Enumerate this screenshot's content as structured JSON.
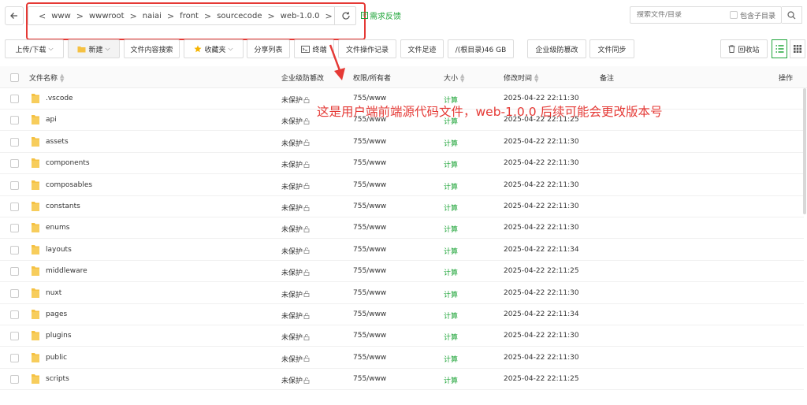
{
  "path": {
    "crumbs": [
      "www",
      "wwwroot",
      "naiai",
      "front",
      "sourcecode",
      "web-1.0.0"
    ],
    "feedback": "需求反馈"
  },
  "search": {
    "placeholder": "搜索文件/目录",
    "subdir_label": "包含子目录"
  },
  "toolbar": {
    "upload": "上传/下载",
    "new": "新建",
    "content_search": "文件内容搜索",
    "favorites": "收藏夹",
    "share_list": "分享列表",
    "terminal": "终端",
    "op_log": "文件操作记录",
    "footprint": "文件足迹",
    "disk": "/(根目录)46 GB",
    "tamper": "企业级防篡改",
    "sync": "文件同步",
    "recycle": "回收站"
  },
  "table": {
    "headers": {
      "name": "文件名称",
      "tamper": "企业级防篡改",
      "perm": "权限/所有者",
      "size": "大小",
      "mtime": "修改时间",
      "remark": "备注",
      "ops": "操作"
    },
    "rows": [
      {
        "name": ".vscode",
        "protect": "未保护",
        "perm": "755/www",
        "size": "计算",
        "mtime": "2025-04-22 22:11:30"
      },
      {
        "name": "api",
        "protect": "未保护",
        "perm": "755/www",
        "size": "计算",
        "mtime": "2025-04-22 22:11:25"
      },
      {
        "name": "assets",
        "protect": "未保护",
        "perm": "755/www",
        "size": "计算",
        "mtime": "2025-04-22 22:11:30"
      },
      {
        "name": "components",
        "protect": "未保护",
        "perm": "755/www",
        "size": "计算",
        "mtime": "2025-04-22 22:11:30"
      },
      {
        "name": "composables",
        "protect": "未保护",
        "perm": "755/www",
        "size": "计算",
        "mtime": "2025-04-22 22:11:30"
      },
      {
        "name": "constants",
        "protect": "未保护",
        "perm": "755/www",
        "size": "计算",
        "mtime": "2025-04-22 22:11:30"
      },
      {
        "name": "enums",
        "protect": "未保护",
        "perm": "755/www",
        "size": "计算",
        "mtime": "2025-04-22 22:11:30"
      },
      {
        "name": "layouts",
        "protect": "未保护",
        "perm": "755/www",
        "size": "计算",
        "mtime": "2025-04-22 22:11:34"
      },
      {
        "name": "middleware",
        "protect": "未保护",
        "perm": "755/www",
        "size": "计算",
        "mtime": "2025-04-22 22:11:25"
      },
      {
        "name": "nuxt",
        "protect": "未保护",
        "perm": "755/www",
        "size": "计算",
        "mtime": "2025-04-22 22:11:30"
      },
      {
        "name": "pages",
        "protect": "未保护",
        "perm": "755/www",
        "size": "计算",
        "mtime": "2025-04-22 22:11:34"
      },
      {
        "name": "plugins",
        "protect": "未保护",
        "perm": "755/www",
        "size": "计算",
        "mtime": "2025-04-22 22:11:30"
      },
      {
        "name": "public",
        "protect": "未保护",
        "perm": "755/www",
        "size": "计算",
        "mtime": "2025-04-22 22:11:30"
      },
      {
        "name": "scripts",
        "protect": "未保护",
        "perm": "755/www",
        "size": "计算",
        "mtime": "2025-04-22 22:11:25"
      }
    ]
  },
  "annotation": "这是用户端前端源代码文件，web-1.0.0 后续可能会更改版本号",
  "colors": {
    "accent": "#20a53a",
    "annotation": "#e53935",
    "folder": "#f5c142"
  },
  "icons": [
    "back-arrow-icon",
    "chevron-left-icon",
    "chevron-right-icon",
    "refresh-icon",
    "feedback-icon",
    "search-icon",
    "chevron-down-icon",
    "folder-icon",
    "star-icon",
    "terminal-icon",
    "trash-icon",
    "list-view-icon",
    "grid-view-icon",
    "lock-icon"
  ]
}
